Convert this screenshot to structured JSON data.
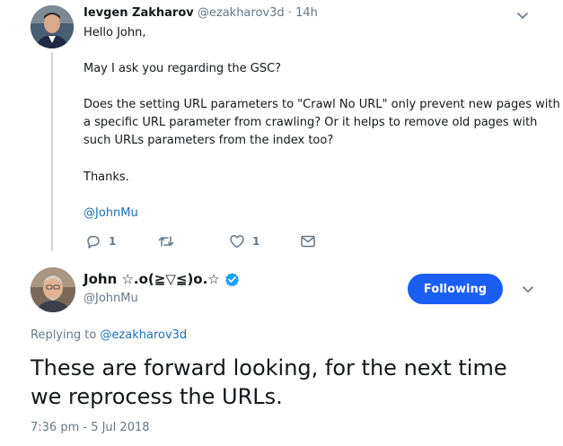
{
  "parent_tweet": {
    "author_name": "Ievgen Zakharov",
    "author_handle": "@ezakharov3d",
    "separator": "·",
    "time": "14h",
    "greeting": "Hello John,",
    "paragraph_ask": "May I ask you regarding the GSC?",
    "question_line_1": "Does the setting URL parameters to \"Crawl No URL\" only prevent new pages with",
    "question_line_2": "a specific URL parameter from crawling? Or it helps to remove old pages with",
    "question_line_3": "such URLs parameters from the index too?",
    "thanks": "Thanks.",
    "mention": "@JohnMu",
    "actions": {
      "reply_count": "1",
      "retweet_count": "",
      "like_count": "1"
    }
  },
  "main_tweet": {
    "author_name": "John ☆.o(≧▽≦)o.☆",
    "author_handle": "@JohnMu",
    "follow_label": "Following",
    "replying_prefix": "Replying to",
    "replying_to": "@ezakharov3d",
    "text": "These are forward looking, for the next time we reprocess the URLs.",
    "timestamp": "7:36 pm - 5 Jul 2018"
  },
  "colors": {
    "link": "#1b6fb3",
    "follow_button": "#1b5ef3",
    "verified": "#1da1f2",
    "muted": "#657786",
    "thread_line": "#ccd6dd"
  },
  "icons": {
    "reply": "reply-icon",
    "retweet": "retweet-icon",
    "like": "heart-icon",
    "dm": "envelope-icon",
    "more": "chevron-down-icon",
    "verified": "verified-badge-icon"
  }
}
